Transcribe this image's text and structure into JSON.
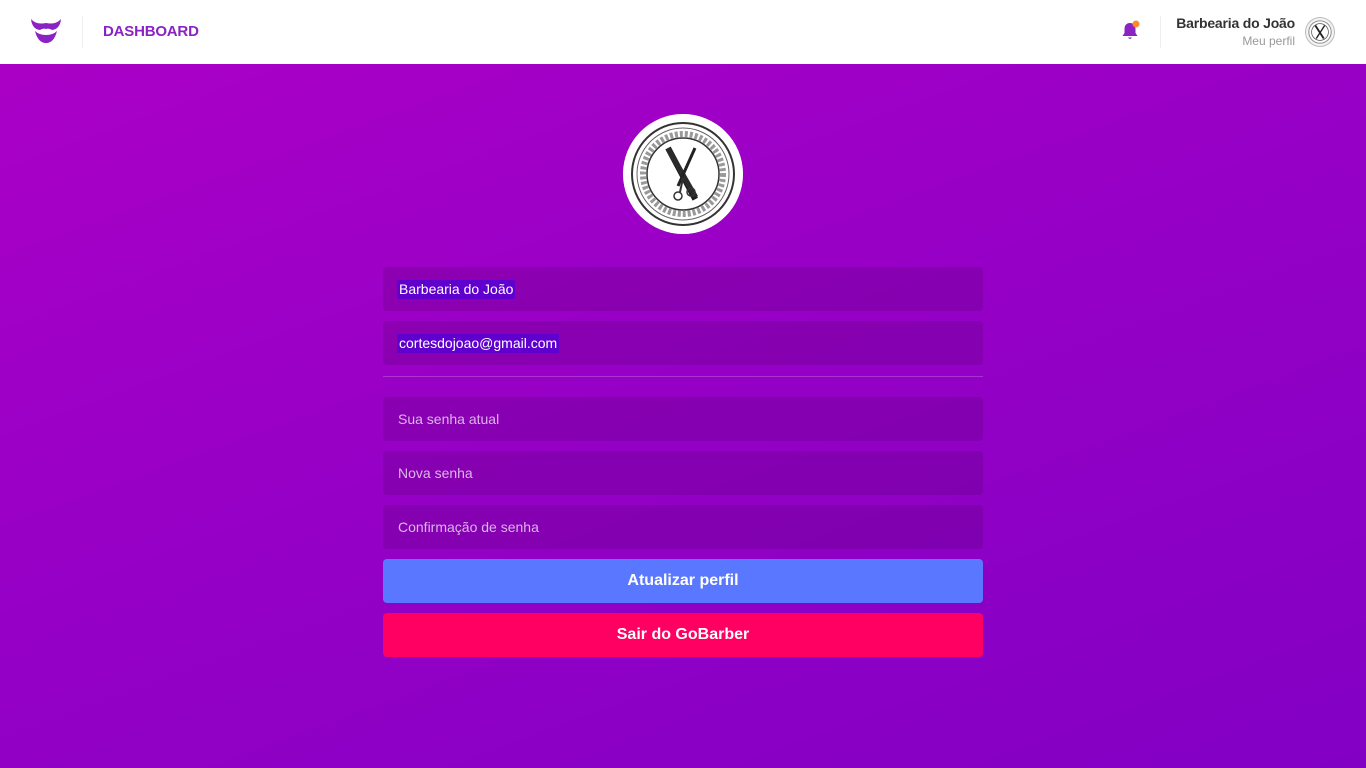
{
  "header": {
    "logo_icon": "barber-mustache-logo",
    "nav_dashboard": "DASHBOARD",
    "notification_icon": "bell-icon",
    "notification_badge_color": "#ff892e",
    "user_name": "Barbearia do João",
    "profile_link": "Meu perfil",
    "avatar_icon": "barber-shop-avatar"
  },
  "profile": {
    "avatar_icon": "barber-shop-seal",
    "avatar_text": "BARBER SHOP"
  },
  "form": {
    "name_value": "Barbearia do João",
    "email_value": "cortesdojoao@gmail.com",
    "old_password_placeholder": "Sua senha atual",
    "new_password_placeholder": "Nova senha",
    "confirm_password_placeholder": "Confirmação de senha",
    "update_button": "Atualizar perfil",
    "logout_button": "Sair do GoBarber"
  },
  "colors": {
    "accent": "#8a22c4",
    "update_button": "#5a78ff",
    "logout_button": "#ff0062",
    "notification_dot": "#ff892e"
  }
}
